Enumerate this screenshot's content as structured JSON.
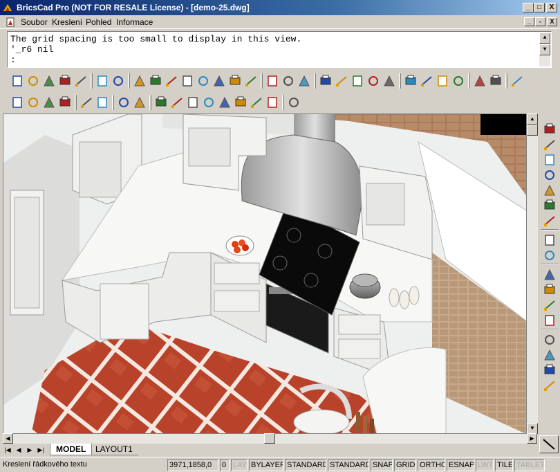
{
  "window": {
    "title": "BricsCad Pro (NOT FOR RESALE License) - [demo-25.dwg]",
    "controls": {
      "minimize": "_",
      "maximize": "□",
      "close": "X"
    }
  },
  "menu": {
    "items": [
      "Soubor",
      "Kreslení",
      "Pohled",
      "Informace"
    ],
    "mdi_controls": {
      "minimize": "_",
      "restore": "▫",
      "close": "X"
    }
  },
  "command": {
    "lines": [
      "The grid spacing is too small to display in this view.",
      "'_r6 nil",
      ":"
    ]
  },
  "toolbar1": [
    "new-icon",
    "open-icon",
    "open-folder-icon",
    "save-icon",
    "print-icon",
    "lock-icon",
    "properties-icon",
    "layer-icon",
    "layer-state-icon",
    "layer-prev-icon",
    "layer-match-icon",
    "layer-iso-icon",
    "layer-off-icon",
    "layer-freeze-icon",
    "layer-lock-icon",
    "copy-layers-icon",
    "copy-objects-icon",
    "list-icon",
    "measure-icon",
    "align-icon",
    "explode-icon",
    "purge-icon",
    "design-center-icon",
    "pencil-icon",
    "line-icon",
    "arc-icon",
    "circle-icon",
    "text-icon",
    "text-style-icon",
    "window-icon"
  ],
  "toolbar2": [
    "ucs-icon",
    "ucs-object-icon",
    "ucs-face-icon",
    "ucs-view-icon",
    "mirror-icon",
    "snap-icon",
    "edit-icon",
    "delete-icon",
    "dim-linear-icon",
    "dim-aligned-icon",
    "dim-angular-icon",
    "dim-baseline-icon",
    "dim-continue-icon",
    "dim-ordinate-icon",
    "dim-radius-icon",
    "dim-diameter-icon",
    "dim-edit-icon"
  ],
  "right_toolbar": [
    "zoom-window-icon",
    "zoom-realtime-icon",
    "zoom-in-icon",
    "zoom-out-icon",
    "zoom-extents-icon",
    "zoom-previous-icon",
    "pan-icon",
    "view-top-icon",
    "view-named-icon",
    "view-front-icon",
    "view-left-icon",
    "view-right-icon",
    "view-back-icon",
    "view-iso-sw-icon",
    "view-iso-se-icon",
    "view-iso-ne-icon",
    "view-iso-nw-icon"
  ],
  "tabs": {
    "nav": [
      "|◀",
      "◀",
      "▶",
      "▶|"
    ],
    "model": "MODEL",
    "layout": "LAYOUT1"
  },
  "status": {
    "prompt": "Kreslení řádkového textu",
    "coords": "3971,1858,0",
    "elevation": "0",
    "layer": "LAY",
    "linetype": "BYLAYER",
    "textstyle": "STANDARD",
    "dimstyle": "STANDARD",
    "snap": "SNAP",
    "grid": "GRID",
    "ortho": "ORTHO",
    "esnap": "ESNAP",
    "lwt": "LWT",
    "tile": "TILE",
    "tablet": "TABLET"
  },
  "colors": {
    "title_start": "#0a246a",
    "title_end": "#a6caf0",
    "floor": "#b8432a",
    "cabinet": "#f0f0ee",
    "hob": "#0a0a0a",
    "tile": "#c9a98c"
  }
}
